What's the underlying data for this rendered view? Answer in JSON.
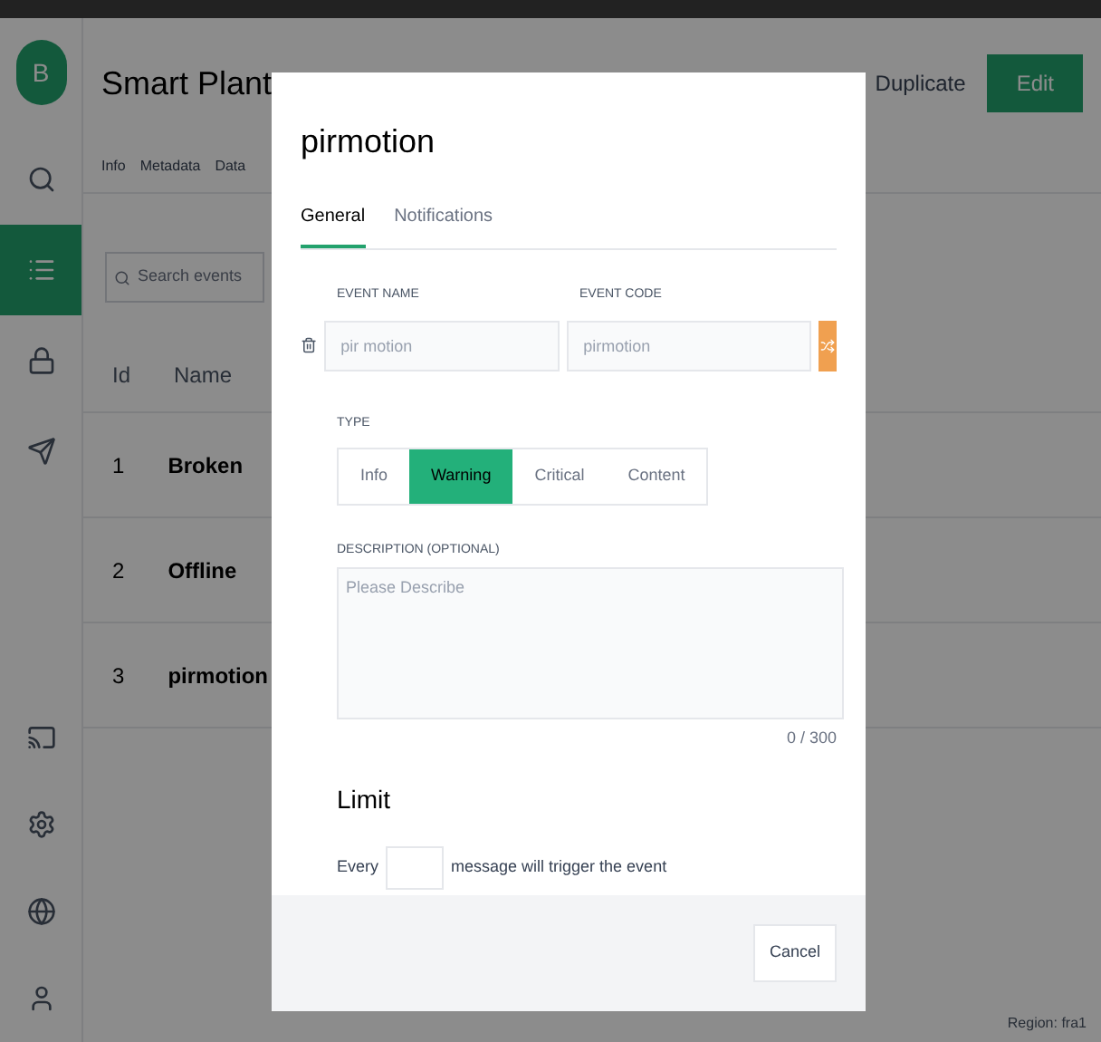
{
  "header": {
    "title": "Smart Plant",
    "actions": [
      "Duplicate",
      "Edit"
    ]
  },
  "tabs": [
    {
      "label": "Info"
    },
    {
      "label": "Metadata"
    },
    {
      "label": "Data"
    }
  ],
  "search": {
    "placeholder": "Search events"
  },
  "table": {
    "columns": [
      "Id",
      "Name"
    ],
    "rows": [
      {
        "id": "1",
        "name": "Broken"
      },
      {
        "id": "2",
        "name": "Offline"
      },
      {
        "id": "3",
        "name": "pirmotion"
      }
    ]
  },
  "sidebar": {
    "items": [
      {
        "selected": false
      },
      {
        "selected": true
      },
      {
        "selected": false
      },
      {
        "selected": false
      }
    ],
    "logo": "B"
  },
  "modal": {
    "title": "pirmotion",
    "tabs": [
      {
        "label": "General",
        "selected": true
      },
      {
        "label": "Notifications",
        "selected": false
      }
    ],
    "name_field": {
      "label": "EVENT NAME",
      "value": "pir motion"
    },
    "code_field": {
      "label": "EVENT CODE",
      "value": "pirmotion"
    },
    "type": {
      "label": "TYPE",
      "options": [
        {
          "label": "Info",
          "selected": false
        },
        {
          "label": "Warning",
          "selected": true
        },
        {
          "label": "Critical",
          "selected": false
        },
        {
          "label": "Content",
          "selected": false
        }
      ]
    },
    "description": {
      "label": "DESCRIPTION (OPTIONAL)",
      "placeholder": "Please Describe",
      "counter": "0 / 300"
    },
    "limit": {
      "title": "Limit",
      "prefix": "Every",
      "suffix": "message will trigger the event"
    },
    "buttons": [
      "Cancel"
    ]
  },
  "footer": {
    "region": "Region: fra1"
  }
}
